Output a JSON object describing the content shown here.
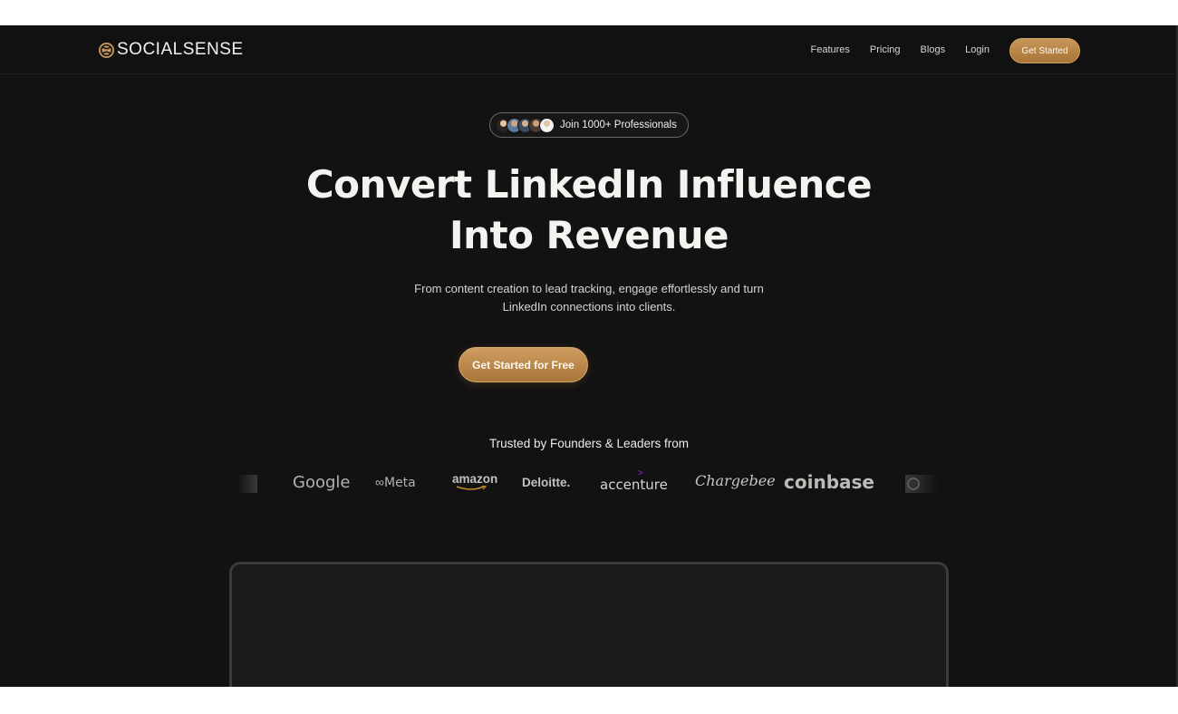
{
  "brand": {
    "name": "SOCIALSENSE"
  },
  "nav": {
    "links": [
      "Features",
      "Pricing",
      "Blogs",
      "Login"
    ],
    "cta": "Get Started"
  },
  "hero": {
    "badge": "Join 1000+ Professionals",
    "headline_line1": "Convert LinkedIn Influence",
    "headline_line2": "Into Revenue",
    "subhead_line1": "From content creation to lead tracking, engage effortlessly and turn",
    "subhead_line2": "LinkedIn connections into clients.",
    "cta": "Get Started for Free"
  },
  "trusted": {
    "heading": "Trusted by Founders & Leaders from",
    "logos": [
      "Google",
      "Meta",
      "amazon",
      "Deloitte.",
      "accenture",
      "Chargebee",
      "coinbase"
    ]
  },
  "colors": {
    "background": "#131213",
    "accent": "#c8965a",
    "text": "#f5f3ef"
  }
}
